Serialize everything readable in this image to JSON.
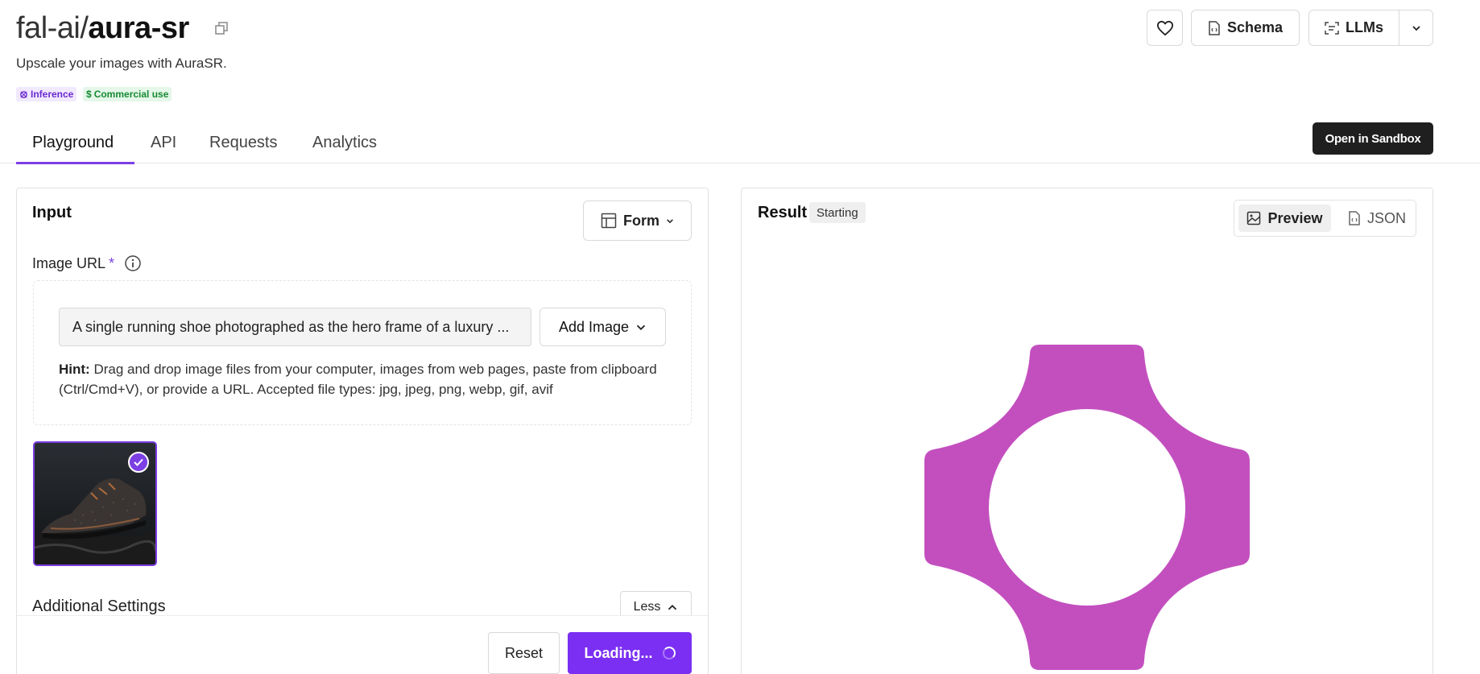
{
  "header": {
    "org": "fal-ai/",
    "model": "aura-sr",
    "subtitle": "Upscale your images with AuraSR.",
    "badges": {
      "inference": "Inference",
      "commercial": "Commercial use"
    },
    "buttons": {
      "schema": "Schema",
      "llms": "LLMs"
    }
  },
  "tabs": [
    "Playground",
    "API",
    "Requests",
    "Analytics"
  ],
  "sandbox_label": "Open in Sandbox",
  "input": {
    "title": "Input",
    "form_toggle": "Form",
    "image_url_label": "Image URL",
    "required_mark": "*",
    "image_url_value": "A single running shoe photographed as the hero frame of a luxury ...",
    "add_image_label": "Add Image",
    "hint_bold": "Hint:",
    "hint_text": " Drag and drop image files from your computer, images from web pages, paste from clipboard (Ctrl/Cmd+V), or provide a URL. Accepted file types: jpg, jpeg, png, webp, gif, avif",
    "additional_settings": "Additional Settings",
    "less_label": "Less",
    "reset_label": "Reset",
    "run_label": "Loading..."
  },
  "result": {
    "title": "Result",
    "status": "Starting",
    "preview_label": "Preview",
    "json_label": "JSON"
  },
  "colors": {
    "accent": "#7b2ff2",
    "logo": "#c34fbf",
    "dark_button": "#1f1f1f"
  }
}
